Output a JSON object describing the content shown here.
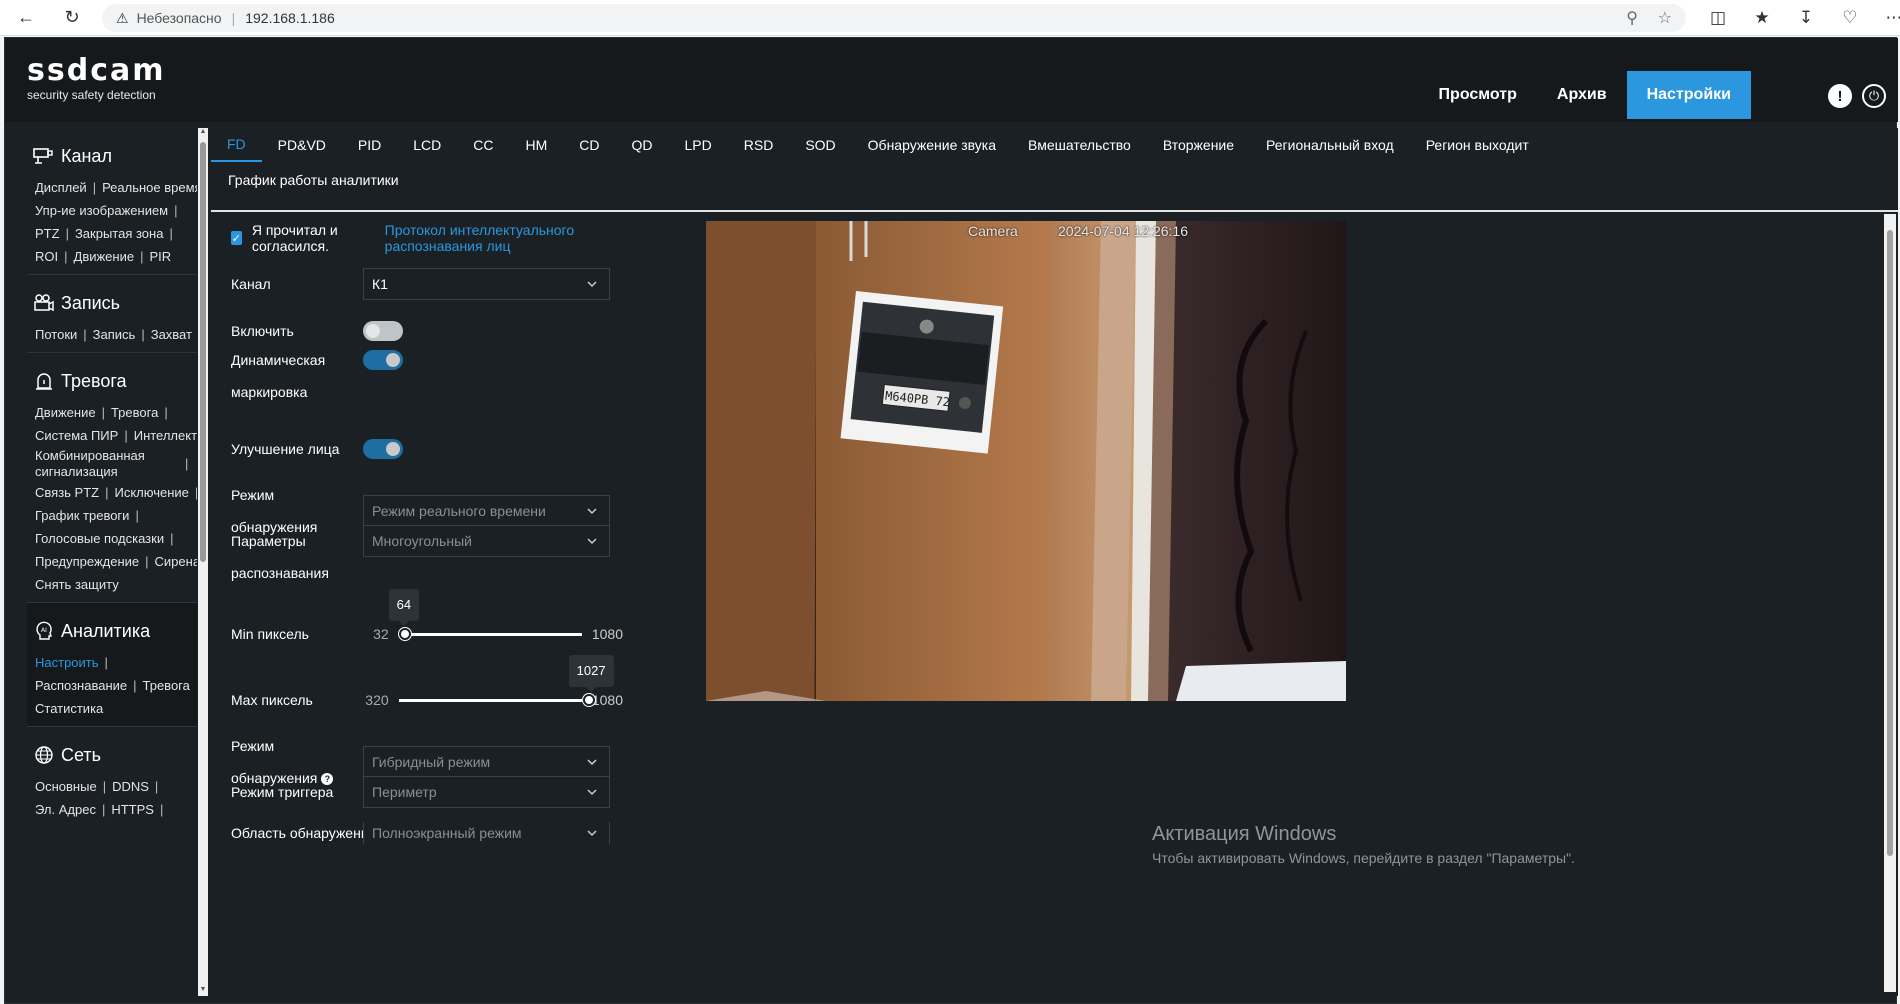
{
  "browser": {
    "insecure_label": "Небезопасно",
    "url": "192.168.1.186"
  },
  "header": {
    "brand": "ssdcam",
    "tagline": "security safety detection",
    "nav": [
      "Просмотр",
      "Архив",
      "Настройки"
    ],
    "active_nav": "Настройки",
    "info_icon": "!"
  },
  "sidebar": {
    "sections": {
      "channel": {
        "title": "Канал",
        "rows": [
          [
            "Дисплей",
            "Реальное время"
          ],
          [
            "Упр-ие изображением"
          ],
          [
            "PTZ",
            "Закрытая зона"
          ],
          [
            "ROI",
            "Движение",
            "PIR"
          ]
        ]
      },
      "record": {
        "title": "Запись",
        "rows": [
          [
            "Потоки",
            "Запись",
            "Захват"
          ]
        ]
      },
      "alarm": {
        "title": "Тревога",
        "rows": [
          [
            "Движение",
            "Тревога"
          ],
          [
            "Система ПИР",
            "Интеллект"
          ],
          [
            "Комбинированная сигнализация"
          ],
          [
            "Связь PTZ",
            "Исключение"
          ],
          [
            "График тревоги"
          ],
          [
            "Голосовые подсказки"
          ],
          [
            "Предупреждение",
            "Сирена"
          ],
          [
            "Снять защиту"
          ]
        ]
      },
      "analytics": {
        "title": "Аналитика",
        "rows": [
          [
            "Настроить"
          ],
          [
            "Распознавание",
            "Тревога"
          ],
          [
            "Статистика"
          ]
        ]
      },
      "network": {
        "title": "Сеть",
        "rows": [
          [
            "Основные",
            "DDNS"
          ],
          [
            "Эл. Адрес",
            "HTTPS"
          ]
        ]
      }
    }
  },
  "tabs": [
    "FD",
    "PD&VD",
    "PID",
    "LCD",
    "CC",
    "HM",
    "CD",
    "QD",
    "LPD",
    "RSD",
    "SOD",
    "Обнаружение звука",
    "Вмешательство",
    "Вторжение",
    "Региональный вход",
    "Регион выходит"
  ],
  "active_tab": "FD",
  "subtab": "График работы аналитики",
  "form": {
    "agree_text": "Я прочитал и согласился.",
    "agree_link": "Протокол интеллектуального распознавания лиц",
    "channel_label": "Канал",
    "channel_value": "К1",
    "enable_label": "Включить",
    "enable_on": false,
    "dynamic_label_1": "Динамическая",
    "dynamic_label_2": "маркировка",
    "dynamic_on": true,
    "face_enh_label": "Улучшение лица",
    "face_enh_on": true,
    "detect_mode_label": "Режим обнаружения",
    "detect_mode_value": "Режим реального времени",
    "recog_label_1": "Параметры",
    "recog_label_2": "распознавания",
    "recog_value": "Многоугольный",
    "min_px_label": "Min пиксель",
    "min_px_min": "32",
    "min_px_max": "1080",
    "min_px_value": "64",
    "max_px_label": "Max пиксель",
    "max_px_min": "320",
    "max_px_max": "1080",
    "max_px_value": "1027",
    "detect_mode2_label": "Режим обнаружения",
    "detect_mode2_value": "Гибридный режим",
    "trigger_label": "Режим триггера",
    "trigger_value": "Периметр",
    "area_label": "Область обнаружения",
    "area_value": "Полноэкранный режим"
  },
  "preview": {
    "osd_name": "Camera",
    "osd_time": "2024-07-04 12:26:16",
    "plate_text": "M640PB 72"
  },
  "windows_activation": {
    "title": "Активация Windows",
    "subtitle": "Чтобы активировать Windows, перейдите в раздел \"Параметры\"."
  }
}
